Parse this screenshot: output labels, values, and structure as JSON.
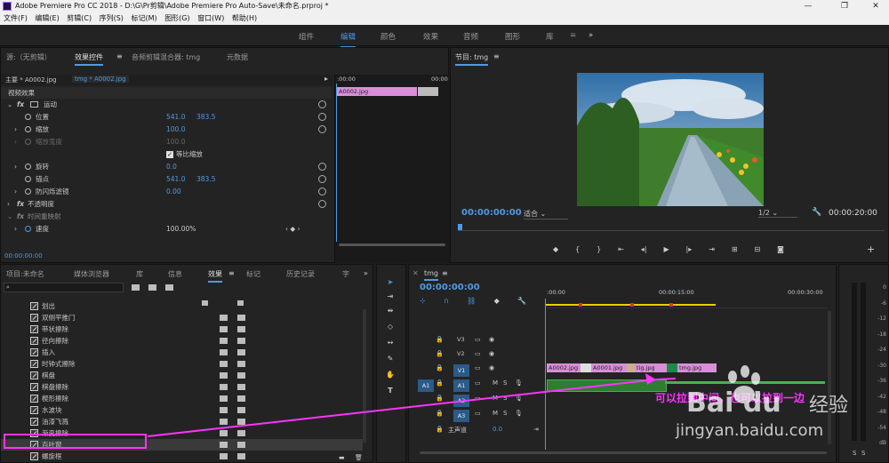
{
  "titlebar": {
    "title": "Adobe Premiere Pro CC 2018 - D:\\G\\Pr剪辑\\Adobe Premiere Pro Auto-Save\\未命名.prproj *",
    "min": "—",
    "max": "❐",
    "close": "✕"
  },
  "menu": [
    "文件(F)",
    "编辑(E)",
    "剪辑(C)",
    "序列(S)",
    "标记(M)",
    "图形(G)",
    "窗口(W)",
    "帮助(H)"
  ],
  "workspaces": {
    "items": [
      "组件",
      "编辑",
      "颜色",
      "效果",
      "音频",
      "图形",
      "库"
    ],
    "active_index": 1,
    "more": "»"
  },
  "source_panel": {
    "tabs": [
      "源:（无剪辑）",
      "效果控件",
      "音频剪辑混合器: tmg",
      "元数据"
    ],
    "active_tab": 1,
    "menu_icon": "≡",
    "seq_labels": [
      "主要 * A0002.jpg",
      "tmg * A0002.jpg"
    ],
    "ruler_left": ":00:00",
    "ruler_right": "00:00",
    "clip_name": "A0002.jpg",
    "section_video": "视频效果",
    "motion": "运动",
    "props": [
      {
        "label": "位置",
        "v1": "541.0",
        "v2": "383.5"
      },
      {
        "label": "缩放",
        "v1": "100.0",
        "v2": ""
      },
      {
        "label": "缩放宽度",
        "v1": "100.0",
        "v2": ""
      },
      {
        "label": "等比缩放",
        "v1": "",
        "v2": ""
      },
      {
        "label": "旋转",
        "v1": "0.0",
        "v2": ""
      },
      {
        "label": "锚点",
        "v1": "541.0",
        "v2": "383.5"
      },
      {
        "label": "防闪烁滤镜",
        "v1": "0.00",
        "v2": ""
      }
    ],
    "opacity": "不透明度",
    "timeremap": "时间重映射",
    "speed": {
      "label": "速度",
      "value": "100.00%"
    },
    "timecode": "00:00:00:00",
    "fx": "fx"
  },
  "program_panel": {
    "title": "节目: tmg",
    "menu_icon": "≡",
    "timecode": "00:00:00:00",
    "fit": "适合",
    "quality": "1/2",
    "duration": "00:00:20:00",
    "controls": [
      "marker-icon",
      "in-icon",
      "out-icon",
      "step-back-icon",
      "play-back-icon",
      "play-icon",
      "play-fwd-icon",
      "step-fwd-icon",
      "insert-icon",
      "overwrite-icon",
      "export-frame-icon",
      "add-icon"
    ]
  },
  "project_panel": {
    "tabs": [
      "项目:未命名",
      "媒体浏览器",
      "库",
      "信息",
      "效果",
      "标记",
      "历史记录",
      "字"
    ],
    "active_tab": 4,
    "more": "»",
    "search_placeholder": "",
    "items": [
      "划出",
      "双侧平推门",
      "带状擦除",
      "径向擦除",
      "插入",
      "时钟式擦除",
      "棋盘",
      "棋盘擦除",
      "楔形擦除",
      "水波块",
      "油漆飞溅",
      "渐变擦除",
      "百叶窗",
      "螺旋框"
    ],
    "highlight_index": 12
  },
  "timeline": {
    "title": "tmg",
    "menu_icon": "≡",
    "timecode": "00:00:00:00",
    "ruler": [
      ":00:00",
      "00:00:15:00",
      "00:00:30:00"
    ],
    "tracks": [
      {
        "name": "V3",
        "type": "video"
      },
      {
        "name": "V2",
        "type": "video"
      },
      {
        "name": "V1",
        "type": "video",
        "source": ""
      },
      {
        "name": "A1",
        "type": "audio",
        "source": "A1",
        "m": "M",
        "s": "S"
      },
      {
        "name": "A2",
        "type": "audio",
        "m": "M",
        "s": "S"
      },
      {
        "name": "A3",
        "type": "audio",
        "m": "M",
        "s": "S"
      }
    ],
    "master": {
      "label": "主声道",
      "value": "0.0"
    },
    "clips": [
      "A0002.jpg",
      "A0001.jpg",
      "tig.jpg",
      "tmg.jpg"
    ]
  },
  "meter": {
    "ticks": [
      "0",
      "-6",
      "-12",
      "-18",
      "-24",
      "-30",
      "-36",
      "-42",
      "-48",
      "-54",
      "dB"
    ],
    "s1": "S",
    "s2": "S"
  },
  "annotation": {
    "text": "可以拉到中间，也可以拉到一边"
  },
  "watermark": {
    "brand": "Bai du",
    "cn": "经验",
    "url": "jingyan.baidu.com"
  },
  "colors": {
    "accent": "#4f9ae5",
    "clip": "#d88fd8",
    "annotation": "#ff33ff",
    "audio_green": "#2e7d32"
  }
}
